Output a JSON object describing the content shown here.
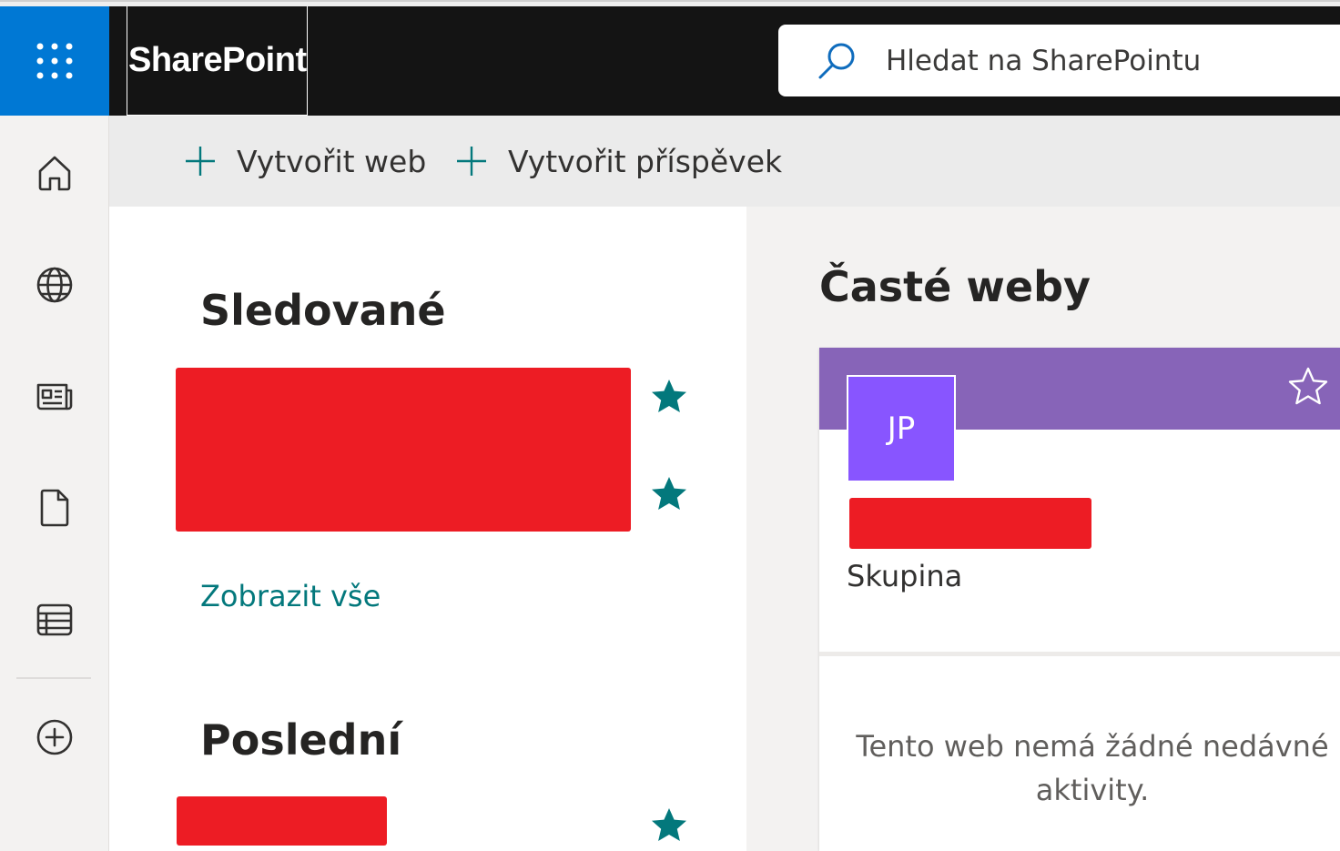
{
  "app": {
    "brand": "SharePoint",
    "search_placeholder": "Hledat na SharePointu",
    "waffle_icon": "waffle-icon",
    "accent": "#0078d4"
  },
  "rail": {
    "items": [
      {
        "name": "home",
        "icon": "home-icon"
      },
      {
        "name": "sites",
        "icon": "globe-icon"
      },
      {
        "name": "news",
        "icon": "news-icon"
      },
      {
        "name": "files",
        "icon": "file-icon"
      },
      {
        "name": "lists",
        "icon": "list-icon"
      },
      {
        "name": "create",
        "icon": "add-circle-icon"
      }
    ]
  },
  "commands": {
    "create_site": "Vytvořit web",
    "create_post": "Vytvořit příspěvek"
  },
  "followed": {
    "title": "Sledované",
    "view_all": "Zobrazit vše",
    "star_color": "#03787c"
  },
  "recent": {
    "title": "Poslední"
  },
  "frequent": {
    "title": "Časté weby",
    "card": {
      "initials": "JP",
      "type": "Skupina",
      "empty_activity": "Tento web nemá žádné nedávné aktivity.",
      "band_color": "#8764b8",
      "avatar_color": "#8855ff"
    }
  }
}
